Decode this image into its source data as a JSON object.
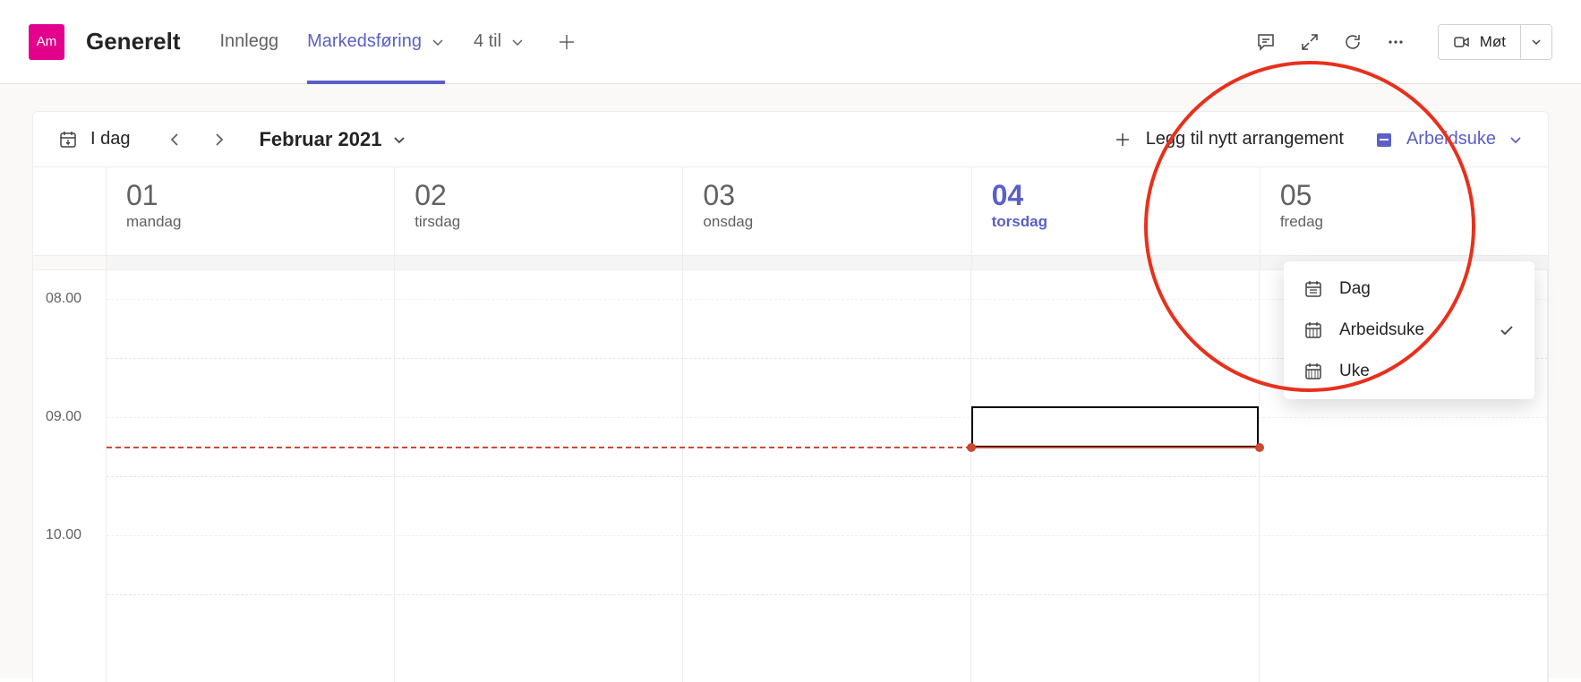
{
  "header": {
    "avatar_initials": "Am",
    "channel_name": "Generelt",
    "tabs": [
      {
        "label": "Innlegg",
        "active": false
      },
      {
        "label": "Markedsføring",
        "active": true,
        "has_dropdown": true
      },
      {
        "label": "4 til",
        "active": false,
        "has_dropdown": true
      }
    ],
    "meet_label": "Møt"
  },
  "toolbar": {
    "today_label": "I dag",
    "month_label": "Februar 2021",
    "add_event_label": "Legg til nytt arrangement",
    "view_label": "Arbeidsuke"
  },
  "days": [
    {
      "num": "01",
      "name": "mandag",
      "today": false
    },
    {
      "num": "02",
      "name": "tirsdag",
      "today": false
    },
    {
      "num": "03",
      "name": "onsdag",
      "today": false
    },
    {
      "num": "04",
      "name": "torsdag",
      "today": true
    },
    {
      "num": "05",
      "name": "fredag",
      "today": false
    }
  ],
  "time_labels": [
    "08.00",
    "09.00",
    "10.00"
  ],
  "dropdown": {
    "items": [
      {
        "label": "Dag",
        "selected": false
      },
      {
        "label": "Arbeidsuke",
        "selected": true
      },
      {
        "label": "Uke",
        "selected": false
      }
    ]
  },
  "now_indicator_hour_fraction": 0.3,
  "colors": {
    "accent": "#5b5fc7",
    "avatar": "#e3008c",
    "now": "#cc4a31",
    "annotation": "#e8301c"
  }
}
